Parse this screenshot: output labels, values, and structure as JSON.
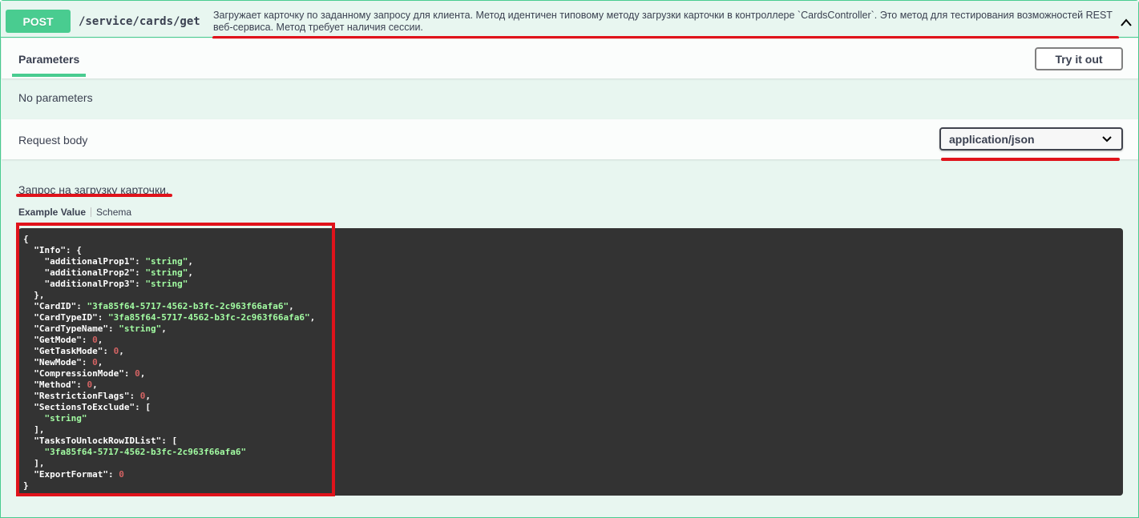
{
  "summary": {
    "method": "POST",
    "path": "/service/cards/get",
    "description": "Загружает карточку по заданному запросу для клиента. Метод идентичен типовому методу загрузки карточки в контроллере `CardsController`. Это метод для тестирования возможностей REST веб-сервиса. Метод требует наличия сессии."
  },
  "tabs": {
    "parameters_label": "Parameters",
    "try_it_out_label": "Try it out"
  },
  "parameters": {
    "empty_text": "No parameters"
  },
  "request_body": {
    "title": "Request body",
    "content_type": "application/json",
    "description": "Запрос на загрузку карточки.",
    "example_tab": "Example Value",
    "schema_tab": "Schema"
  },
  "example_json": [
    [
      [
        "p",
        "{"
      ]
    ],
    [
      [
        "p",
        "  "
      ],
      [
        "k",
        "\"Info\""
      ],
      [
        "p",
        ": {"
      ]
    ],
    [
      [
        "p",
        "    "
      ],
      [
        "k",
        "\"additionalProp1\""
      ],
      [
        "p",
        ": "
      ],
      [
        "s",
        "\"string\""
      ],
      [
        "p",
        ","
      ]
    ],
    [
      [
        "p",
        "    "
      ],
      [
        "k",
        "\"additionalProp2\""
      ],
      [
        "p",
        ": "
      ],
      [
        "s",
        "\"string\""
      ],
      [
        "p",
        ","
      ]
    ],
    [
      [
        "p",
        "    "
      ],
      [
        "k",
        "\"additionalProp3\""
      ],
      [
        "p",
        ": "
      ],
      [
        "s",
        "\"string\""
      ]
    ],
    [
      [
        "p",
        "  },"
      ]
    ],
    [
      [
        "p",
        "  "
      ],
      [
        "k",
        "\"CardID\""
      ],
      [
        "p",
        ": "
      ],
      [
        "s",
        "\"3fa85f64-5717-4562-b3fc-2c963f66afa6\""
      ],
      [
        "p",
        ","
      ]
    ],
    [
      [
        "p",
        "  "
      ],
      [
        "k",
        "\"CardTypeID\""
      ],
      [
        "p",
        ": "
      ],
      [
        "s",
        "\"3fa85f64-5717-4562-b3fc-2c963f66afa6\""
      ],
      [
        "p",
        ","
      ]
    ],
    [
      [
        "p",
        "  "
      ],
      [
        "k",
        "\"CardTypeName\""
      ],
      [
        "p",
        ": "
      ],
      [
        "s",
        "\"string\""
      ],
      [
        "p",
        ","
      ]
    ],
    [
      [
        "p",
        "  "
      ],
      [
        "k",
        "\"GetMode\""
      ],
      [
        "p",
        ": "
      ],
      [
        "n",
        "0"
      ],
      [
        "p",
        ","
      ]
    ],
    [
      [
        "p",
        "  "
      ],
      [
        "k",
        "\"GetTaskMode\""
      ],
      [
        "p",
        ": "
      ],
      [
        "n",
        "0"
      ],
      [
        "p",
        ","
      ]
    ],
    [
      [
        "p",
        "  "
      ],
      [
        "k",
        "\"NewMode\""
      ],
      [
        "p",
        ": "
      ],
      [
        "n",
        "0"
      ],
      [
        "p",
        ","
      ]
    ],
    [
      [
        "p",
        "  "
      ],
      [
        "k",
        "\"CompressionMode\""
      ],
      [
        "p",
        ": "
      ],
      [
        "n",
        "0"
      ],
      [
        "p",
        ","
      ]
    ],
    [
      [
        "p",
        "  "
      ],
      [
        "k",
        "\"Method\""
      ],
      [
        "p",
        ": "
      ],
      [
        "n",
        "0"
      ],
      [
        "p",
        ","
      ]
    ],
    [
      [
        "p",
        "  "
      ],
      [
        "k",
        "\"RestrictionFlags\""
      ],
      [
        "p",
        ": "
      ],
      [
        "n",
        "0"
      ],
      [
        "p",
        ","
      ]
    ],
    [
      [
        "p",
        "  "
      ],
      [
        "k",
        "\"SectionsToExclude\""
      ],
      [
        "p",
        ": ["
      ]
    ],
    [
      [
        "p",
        "    "
      ],
      [
        "s",
        "\"string\""
      ]
    ],
    [
      [
        "p",
        "  ],"
      ]
    ],
    [
      [
        "p",
        "  "
      ],
      [
        "k",
        "\"TasksToUnlockRowIDList\""
      ],
      [
        "p",
        ": ["
      ]
    ],
    [
      [
        "p",
        "    "
      ],
      [
        "s",
        "\"3fa85f64-5717-4562-b3fc-2c963f66afa6\""
      ]
    ],
    [
      [
        "p",
        "  ],"
      ]
    ],
    [
      [
        "p",
        "  "
      ],
      [
        "k",
        "\"ExportFormat\""
      ],
      [
        "p",
        ": "
      ],
      [
        "n",
        "0"
      ]
    ],
    [
      [
        "p",
        "}"
      ]
    ]
  ],
  "colors": {
    "accent_green": "#49cc90",
    "highlight_red": "#e0131b",
    "code_background": "#333333",
    "code_string": "#a2fca2",
    "code_number": "#d36363"
  },
  "icons": {
    "collapse": "chevron-up-icon",
    "select": "chevron-down-icon"
  }
}
